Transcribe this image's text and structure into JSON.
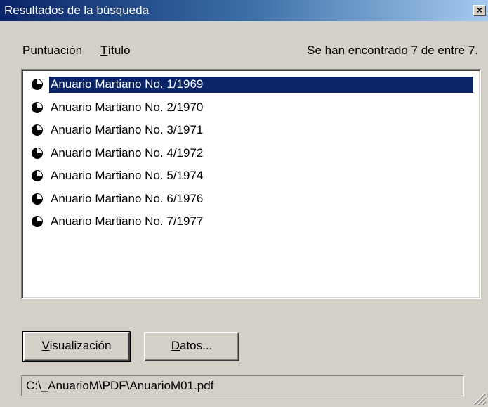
{
  "window": {
    "title": "Resultados de la búsqueda",
    "close_label": "×"
  },
  "header": {
    "score_label": "Puntuación",
    "title_label_first": "T",
    "title_label_rest": "ítulo",
    "found_text": "Se han encontrado 7 de entre 7."
  },
  "results": {
    "items": [
      {
        "label": "Anuario Martiano No. 1/1969",
        "relevance": 0.75,
        "selected": true
      },
      {
        "label": "Anuario Martiano No. 2/1970",
        "relevance": 0.75,
        "selected": false
      },
      {
        "label": "Anuario Martiano No. 3/1971",
        "relevance": 0.75,
        "selected": false
      },
      {
        "label": "Anuario Martiano No. 4/1972",
        "relevance": 0.75,
        "selected": false
      },
      {
        "label": "Anuario Martiano No. 5/1974",
        "relevance": 0.75,
        "selected": false
      },
      {
        "label": "Anuario Martiano No. 6/1976",
        "relevance": 0.75,
        "selected": false
      },
      {
        "label": "Anuario Martiano No. 7/1977",
        "relevance": 0.75,
        "selected": false
      }
    ]
  },
  "buttons": {
    "view_first": "V",
    "view_rest": "isualización",
    "data_first": "D",
    "data_rest": "atos..."
  },
  "status": {
    "path": "C:\\_AnuarioM\\PDF\\AnuarioM01.pdf"
  },
  "colors": {
    "selection": "#0a246a",
    "face": "#d4d0c8"
  }
}
